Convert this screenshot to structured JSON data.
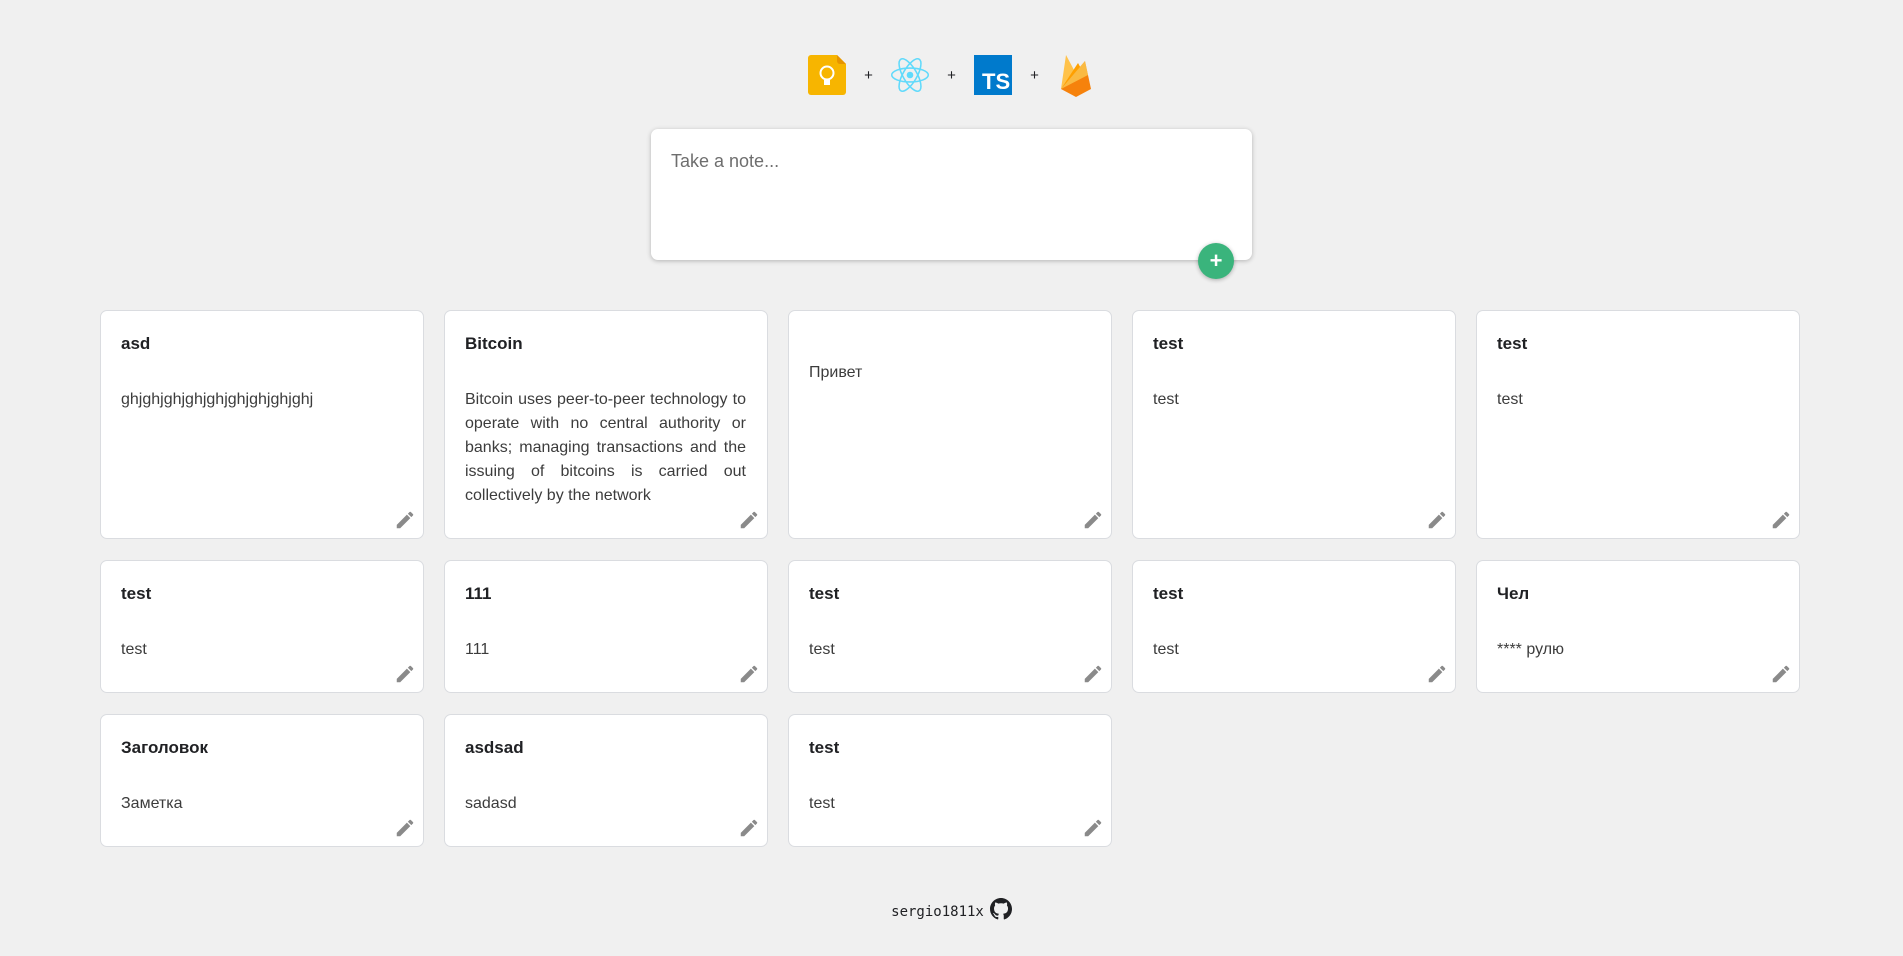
{
  "header": {
    "logos": [
      {
        "icon": "google-keep-icon",
        "color": "#f7b500"
      },
      {
        "icon": "react-icon",
        "color": "#61dafb"
      },
      {
        "icon": "typescript-icon",
        "color": "#007acc"
      },
      {
        "icon": "firebase-icon",
        "color": "#ffa000"
      }
    ],
    "separator": "+"
  },
  "composer": {
    "placeholder": "Take a note...",
    "add_label": "+"
  },
  "notes": [
    {
      "title": "asd",
      "text": "ghjghjghjghjghjghjghjghjghj"
    },
    {
      "title": "Bitcoin",
      "text": "Bitcoin uses peer-to-peer technology to operate with no central authority or banks; managing transactions and the issuing of bitcoins is carried out collectively by the network"
    },
    {
      "title": "",
      "text": "Привет"
    },
    {
      "title": "test",
      "text": "test"
    },
    {
      "title": "test",
      "text": "test"
    },
    {
      "title": "test",
      "text": "test"
    },
    {
      "title": "111",
      "text": "111"
    },
    {
      "title": "test",
      "text": "test"
    },
    {
      "title": "test",
      "text": "test"
    },
    {
      "title": "Чел",
      "text": "**** рулю"
    },
    {
      "title": "Заголовок",
      "text": "Заметка"
    },
    {
      "title": "asdsad",
      "text": "sadasd"
    },
    {
      "title": "test",
      "text": "test"
    }
  ],
  "footer": {
    "author": "sergio1811x",
    "icon": "github-icon"
  },
  "colors": {
    "background": "#f0f0f0",
    "accent": "#3ab47c"
  }
}
